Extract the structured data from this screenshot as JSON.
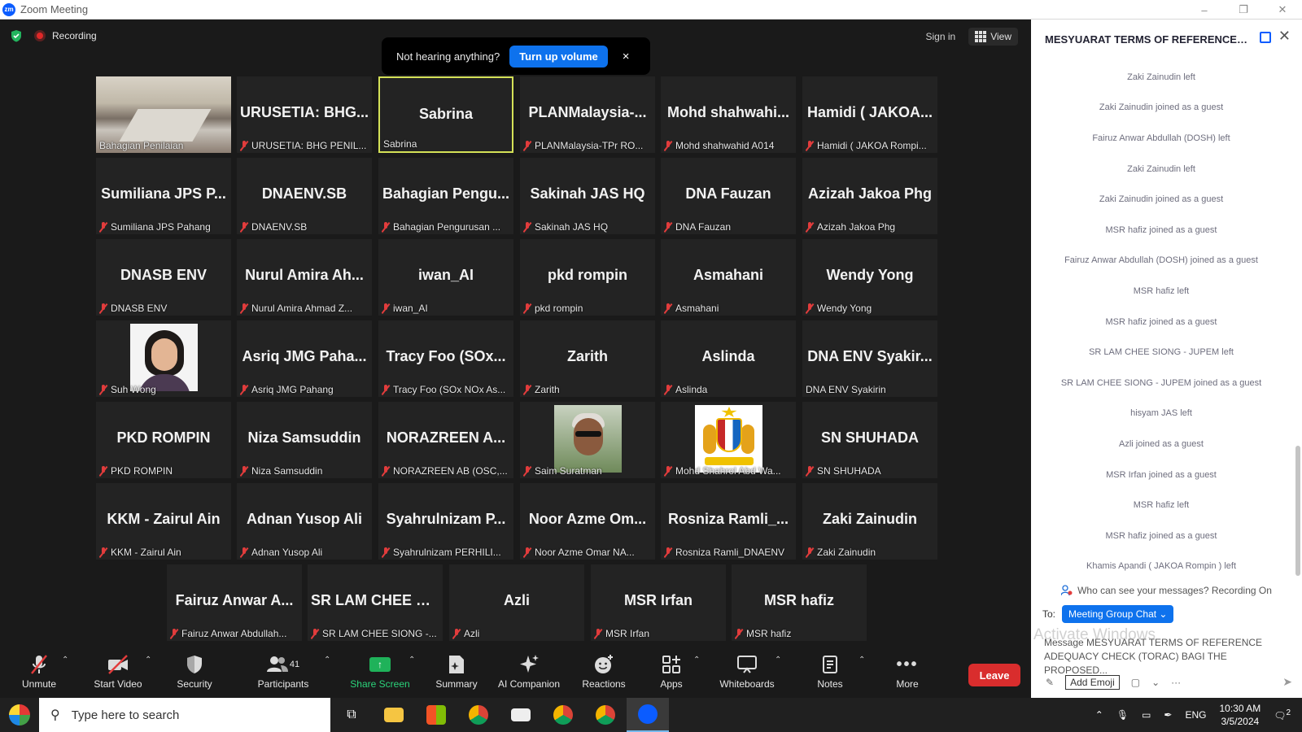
{
  "window": {
    "title": "Zoom Meeting",
    "controls": [
      "–",
      "❐",
      "✕"
    ]
  },
  "meeting_top": {
    "recording_label": "Recording",
    "sign_in": "Sign in",
    "view_label": "View"
  },
  "notification": {
    "message": "Not hearing anything?",
    "button": "Turn up volume",
    "close": "×"
  },
  "tiles": [
    {
      "big": "",
      "label": "Bahagian Penilaian",
      "muted": false,
      "photo": "room"
    },
    {
      "big": "URUSETIA: BHG...",
      "label": "URUSETIA: BHG PENIL...",
      "muted": true
    },
    {
      "big": "Sabrina",
      "label": "Sabrina",
      "muted": false,
      "active": true
    },
    {
      "big": "PLANMalaysia-...",
      "label": "PLANMalaysia-TPr RO...",
      "muted": true
    },
    {
      "big": "Mohd shahwahi...",
      "label": "Mohd shahwahid A014",
      "muted": true
    },
    {
      "big": "Hamidi ( JAKOA...",
      "label": "Hamidi ( JAKOA Rompi...",
      "muted": true
    },
    {
      "big": "Sumiliana JPS P...",
      "label": "Sumiliana JPS Pahang",
      "muted": true
    },
    {
      "big": "DNAENV.SB",
      "label": "DNAENV.SB",
      "muted": true
    },
    {
      "big": "Bahagian Pengu...",
      "label": "Bahagian Pengurusan ...",
      "muted": true
    },
    {
      "big": "Sakinah JAS HQ",
      "label": "Sakinah JAS HQ",
      "muted": true
    },
    {
      "big": "DNA Fauzan",
      "label": "DNA Fauzan",
      "muted": true
    },
    {
      "big": "Azizah Jakoa Phg",
      "label": "Azizah Jakoa Phg",
      "muted": true
    },
    {
      "big": "DNASB ENV",
      "label": "DNASB ENV",
      "muted": true
    },
    {
      "big": "Nurul Amira Ah...",
      "label": "Nurul Amira Ahmad Z...",
      "muted": true
    },
    {
      "big": "iwan_AI",
      "label": "iwan_AI",
      "muted": true
    },
    {
      "big": "pkd rompin",
      "label": "pkd rompin",
      "muted": true
    },
    {
      "big": "Asmahani",
      "label": "Asmahani",
      "muted": true
    },
    {
      "big": "Wendy Yong",
      "label": "Wendy Yong",
      "muted": true
    },
    {
      "big": "",
      "label": "Suh Wong",
      "muted": true,
      "photo": "portrait"
    },
    {
      "big": "Asriq JMG Paha...",
      "label": "Asriq JMG Pahang",
      "muted": true
    },
    {
      "big": "Tracy Foo (SOx...",
      "label": "Tracy Foo (SOx NOx As...",
      "muted": true
    },
    {
      "big": "Zarith",
      "label": "Zarith",
      "muted": true
    },
    {
      "big": "Aslinda",
      "label": "Aslinda",
      "muted": true
    },
    {
      "big": "DNA ENV Syakir...",
      "label": "DNA ENV Syakirin",
      "muted": false
    },
    {
      "big": "PKD ROMPIN",
      "label": "PKD ROMPIN",
      "muted": true
    },
    {
      "big": "Niza Samsuddin",
      "label": "Niza Samsuddin",
      "muted": true
    },
    {
      "big": "NORAZREEN A...",
      "label": "NORAZREEN AB (OSC,...",
      "muted": true
    },
    {
      "big": "",
      "label": "Saim Suratman",
      "muted": true,
      "photo": "man"
    },
    {
      "big": "",
      "label": "Mohd Shahrol Abd Wa...",
      "muted": true,
      "photo": "crest"
    },
    {
      "big": "SN SHUHADA",
      "label": "SN SHUHADA",
      "muted": true
    },
    {
      "big": "KKM - Zairul Ain",
      "label": "KKM - Zairul Ain",
      "muted": true
    },
    {
      "big": "Adnan Yusop Ali",
      "label": "Adnan Yusop Ali",
      "muted": true
    },
    {
      "big": "Syahrulnizam P...",
      "label": "Syahrulnizam PERHILI...",
      "muted": true
    },
    {
      "big": "Noor Azme Om...",
      "label": "Noor Azme Omar NA...",
      "muted": true
    },
    {
      "big": "Rosniza Ramli_...",
      "label": "Rosniza Ramli_DNAENV",
      "muted": true
    },
    {
      "big": "Zaki Zainudin",
      "label": "Zaki Zainudin",
      "muted": true
    },
    {
      "big": "Fairuz Anwar A...",
      "label": "Fairuz Anwar Abdullah...",
      "muted": true
    },
    {
      "big": "SR LAM CHEE SI...",
      "label": "SR LAM CHEE SIONG -...",
      "muted": true
    },
    {
      "big": "Azli",
      "label": "Azli",
      "muted": true
    },
    {
      "big": "MSR Irfan",
      "label": "MSR Irfan",
      "muted": true
    },
    {
      "big": "MSR hafiz",
      "label": "MSR hafiz",
      "muted": true
    }
  ],
  "toolbar": {
    "unmute": "Unmute",
    "start_video": "Start Video",
    "security": "Security",
    "participants": "Participants",
    "participant_count": "41",
    "share_screen": "Share Screen",
    "summary": "Summary",
    "ai_companion": "AI Companion",
    "reactions": "Reactions",
    "apps": "Apps",
    "whiteboards": "Whiteboards",
    "notes": "Notes",
    "more": "More",
    "leave": "Leave"
  },
  "chat": {
    "title": "MESYUARAT TERMS OF REFERENCE A...",
    "messages": [
      "Zaki Zainudin left",
      "Zaki Zainudin joined as a guest",
      "Fairuz Anwar Abdullah (DOSH) left",
      "Zaki Zainudin left",
      "Zaki Zainudin joined as a guest",
      "MSR hafiz joined as a guest",
      "Fairuz Anwar Abdullah (DOSH) joined as a guest",
      "MSR hafiz left",
      "MSR hafiz joined as a guest",
      "SR LAM CHEE SIONG - JUPEM left",
      "SR LAM CHEE SIONG - JUPEM joined as a guest",
      "hisyam JAS left",
      "Azli joined as a guest",
      "MSR Irfan joined as a guest",
      "MSR hafiz left",
      "MSR hafiz joined as a guest",
      "Khamis Apandi ( JAKOA Rompin ) left"
    ],
    "visibility": "Who can see your messages? Recording On",
    "to_label": "To:",
    "recipient": "Meeting Group Chat",
    "compose_text": "Message MESYUARAT TERMS OF REFERENCE ADEQUACY CHECK (TORAC) BAGI THE PROPOSED...",
    "add_emoji_tip": "Add Emoji",
    "watermark": "Activate Windows"
  },
  "taskbar": {
    "search_placeholder": "Type here to search",
    "language": "ENG",
    "time": "10:30 AM",
    "date": "3/5/2024",
    "notification_count": "2"
  },
  "colors": {
    "zoom_blue": "#0e72ed",
    "leave_red": "#d92d2d",
    "share_green": "#1fb25a",
    "active_speaker": "#d4e157",
    "muted_red": "#e23c3c"
  }
}
